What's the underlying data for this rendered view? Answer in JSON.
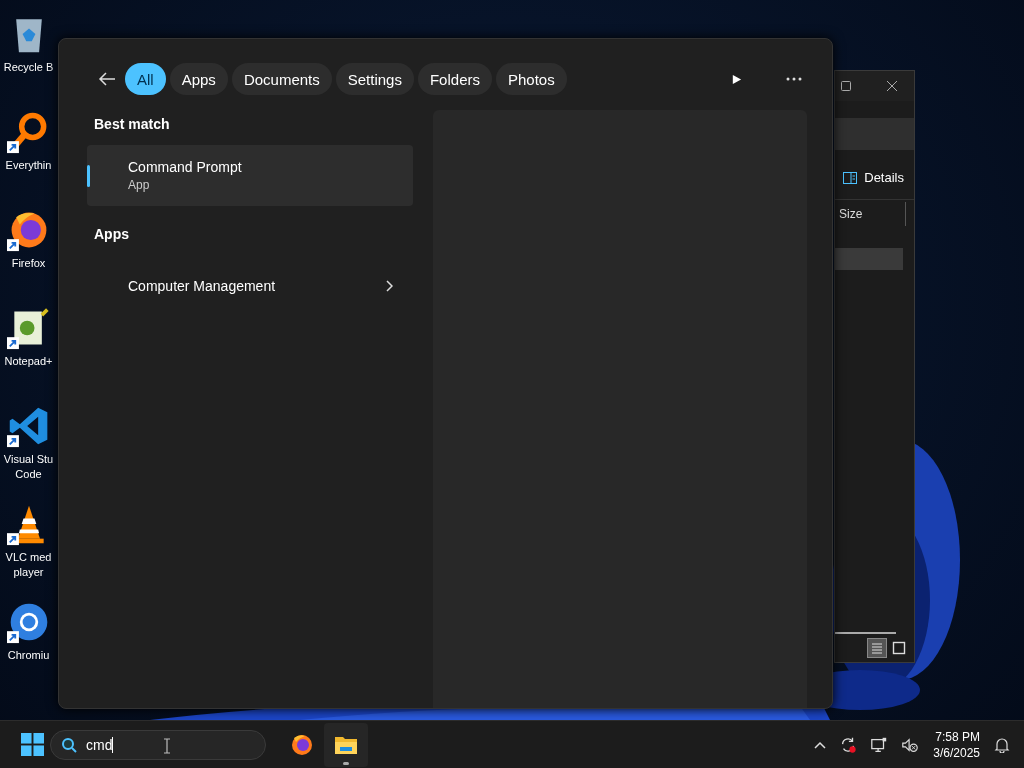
{
  "desktop_icons": [
    {
      "kind": "recycle-bin",
      "lines": [
        "Recycle B"
      ],
      "shortcut": false
    },
    {
      "kind": "magnifier",
      "lines": [
        "Everythin"
      ],
      "shortcut": true
    },
    {
      "kind": "firefox",
      "lines": [
        "Firefox"
      ],
      "shortcut": true
    },
    {
      "kind": "notepad",
      "lines": [
        "Notepad+"
      ],
      "shortcut": true
    },
    {
      "kind": "vscode",
      "lines": [
        "Visual Stu",
        "Code"
      ],
      "shortcut": true
    },
    {
      "kind": "vlc",
      "lines": [
        "VLC med",
        "player"
      ],
      "shortcut": true
    },
    {
      "kind": "chromium",
      "lines": [
        "Chromiu"
      ],
      "shortcut": true
    }
  ],
  "explorer": {
    "toolbar_label": "Details",
    "column_header": "Size",
    "views": [
      {
        "kind": "details",
        "selected": true
      },
      {
        "kind": "tiles",
        "selected": false
      }
    ]
  },
  "search_panel": {
    "filters": [
      {
        "label": "All",
        "selected": true
      },
      {
        "label": "Apps",
        "selected": false
      },
      {
        "label": "Documents",
        "selected": false
      },
      {
        "label": "Settings",
        "selected": false
      },
      {
        "label": "Folders",
        "selected": false
      },
      {
        "label": "Photos",
        "selected": false
      }
    ],
    "sections": [
      {
        "heading": "Best match",
        "items": [
          {
            "title": "Command Prompt",
            "subtitle": "App",
            "selected": true,
            "expandable": false
          }
        ]
      },
      {
        "heading": "Apps",
        "items": [
          {
            "title": "Computer Management",
            "selected": false,
            "expandable": true
          }
        ]
      }
    ]
  },
  "taskbar": {
    "search_value": "cmd",
    "apps": [
      {
        "kind": "firefox",
        "running": false
      },
      {
        "kind": "explorer",
        "running": true
      }
    ],
    "time": "7:58 PM",
    "date": "3/6/2025"
  }
}
